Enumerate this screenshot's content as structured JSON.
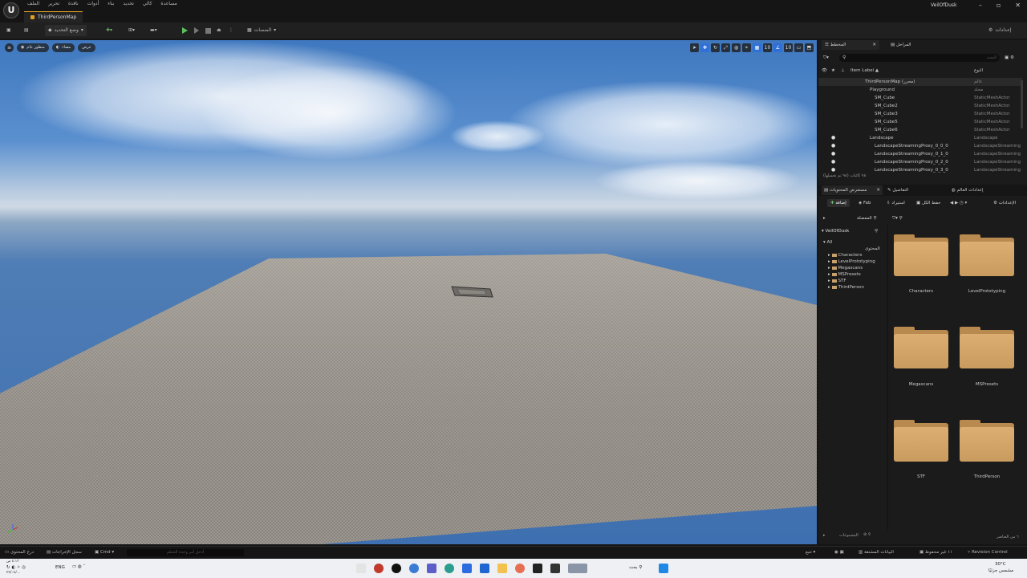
{
  "titlebar": {
    "menus": [
      "الملف",
      "تحرير",
      "نافذة",
      "أدوات",
      "بناء",
      "تحديد",
      "كالي",
      "مساعدة"
    ],
    "map_tab": "ThirdPersonMap",
    "project_name": "VeilOfDusk",
    "window_controls": [
      "–",
      "▫",
      "✕"
    ]
  },
  "toolbar": {
    "select_mode": "وضع التحديد",
    "platforms": "المنصات",
    "settings": "إعدادات"
  },
  "viewport": {
    "perspective": "منظور عام",
    "lit": "مضاء",
    "show": "عرض"
  },
  "outliner": {
    "tab_outliner": "المخطط",
    "tab_levels": "المراحل",
    "search_placeholder": "البحث",
    "col_label": "Item Label ▲",
    "col_type": "النوع",
    "rows": [
      {
        "name": "ThirdPersonMap (محرر)",
        "type": "عالم",
        "indent": 58,
        "eye": ""
      },
      {
        "name": "Playground",
        "type": "مجلد",
        "indent": 64,
        "eye": ""
      },
      {
        "name": "SM_Cube",
        "type": "StaticMeshActor",
        "indent": 70,
        "eye": ""
      },
      {
        "name": "SM_Cube2",
        "type": "StaticMeshActor",
        "indent": 70,
        "eye": ""
      },
      {
        "name": "SM_Cube3",
        "type": "StaticMeshActor",
        "indent": 70,
        "eye": ""
      },
      {
        "name": "SM_Cube5",
        "type": "StaticMeshActor",
        "indent": 70,
        "eye": ""
      },
      {
        "name": "SM_Cube6",
        "type": "StaticMeshActor",
        "indent": 70,
        "eye": ""
      },
      {
        "name": "Landscape",
        "type": "Landscape",
        "indent": 64,
        "eye": "●"
      },
      {
        "name": "LandscapeStreamingProxy_0_0_0",
        "type": "LandscapeStreamingProxy",
        "indent": 70,
        "eye": "●"
      },
      {
        "name": "LandscapeStreamingProxy_0_1_0",
        "type": "LandscapeStreamingProxy",
        "indent": 70,
        "eye": "●"
      },
      {
        "name": "LandscapeStreamingProxy_0_2_0",
        "type": "LandscapeStreamingProxy",
        "indent": 70,
        "eye": "●"
      },
      {
        "name": "LandscapeStreamingProxy_0_3_0",
        "type": "LandscapeStreamingProxy",
        "indent": 70,
        "eye": "●"
      }
    ],
    "status": "٩٨ كائنات (٩٨ تم تحميلها)"
  },
  "content_browser": {
    "tab_browser": "مستعرض المحتويات",
    "tab_details": "التفاصيل",
    "tab_world": "إعدادات العالم",
    "add": "إضافة",
    "fab": "Fab",
    "import": "استيراد",
    "save_all": "حفظ الكل",
    "settings": "الإعدادات",
    "favorites": "المفضلة",
    "project": "VeilOfDusk",
    "content_label": "المحتوى",
    "tree": [
      "All",
      "Characters",
      "LevelPrototyping",
      "Megascans",
      "MSPresets",
      "STF",
      "ThirdPerson"
    ],
    "folders": [
      "Characters",
      "LevelPrototyping",
      "Megascans",
      "MSPresets",
      "STF",
      "ThirdPerson"
    ],
    "collections": "المجموعات",
    "item_count": "٦ من العناصر"
  },
  "statusbar": {
    "content_drawer": "درج المحتوى",
    "output_log": "سجل الإخراجات",
    "cmd": "Cmd",
    "cmd_placeholder": "أدخل أمر وحدة التحكم",
    "trace": "تتبع",
    "derived_data": "البيانات المشتقة",
    "unsaved": "١١ غير محفوظ",
    "revision_control": "Revision Control"
  },
  "taskbar": {
    "lang": "ENG",
    "search": "بحث",
    "clock_time": "٤:١٣ ص",
    "clock_date": "٢٧/٠٤/...",
    "weather_temp": "30°C",
    "weather_desc": "مشمس جزئيًا"
  }
}
